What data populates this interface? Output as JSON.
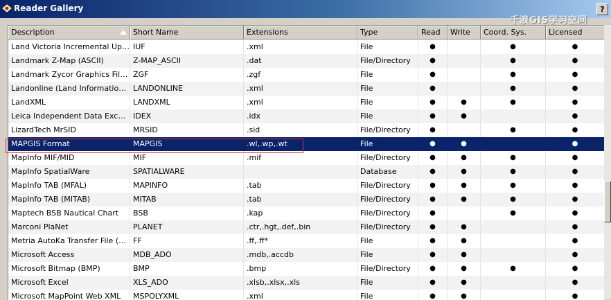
{
  "window": {
    "title": "Reader Gallery",
    "help_label": "?",
    "watermark": "千浪GIS学习空间"
  },
  "columns": [
    "Description",
    "Short Name",
    "Extensions",
    "Type",
    "Read",
    "Write",
    "Coord. Sys.",
    "Licensed"
  ],
  "dot": "●",
  "rows": [
    {
      "desc": "Land Victoria Incremental Update...",
      "short": "IUF",
      "ext": ".xml",
      "type": "File",
      "read": true,
      "write": false,
      "coord": true,
      "lic": true
    },
    {
      "desc": "Landmark Z-Map (ASCII)",
      "short": "Z-MAP_ASCII",
      "ext": ".dat",
      "type": "File/Directory",
      "read": true,
      "write": false,
      "coord": true,
      "lic": true
    },
    {
      "desc": "Landmark Zycor Graphics File (ZGF)",
      "short": "ZGF",
      "ext": ".zgf",
      "type": "File",
      "read": true,
      "write": false,
      "coord": true,
      "lic": true
    },
    {
      "desc": "Landonline (Land Information Ne...",
      "short": "LANDONLINE",
      "ext": ".xml",
      "type": "File",
      "read": true,
      "write": false,
      "coord": true,
      "lic": true
    },
    {
      "desc": "LandXML",
      "short": "LANDXML",
      "ext": ".xml",
      "type": "File",
      "read": true,
      "write": true,
      "coord": true,
      "lic": true
    },
    {
      "desc": "Leica Independent Data Exchang...",
      "short": "IDEX",
      "ext": ".idx",
      "type": "File",
      "read": true,
      "write": true,
      "coord": false,
      "lic": true
    },
    {
      "desc": "LizardTech MrSID",
      "short": "MRSID",
      "ext": ".sid",
      "type": "File/Directory",
      "read": true,
      "write": false,
      "coord": true,
      "lic": true
    },
    {
      "desc": "MAPGIS Format",
      "short": "MAPGIS",
      "ext": ".wl,.wp,.wt",
      "type": "File",
      "read": true,
      "write": true,
      "coord": false,
      "lic": true,
      "selected": true
    },
    {
      "desc": "MapInfo MIF/MID",
      "short": "MIF",
      "ext": ".mif",
      "type": "File/Directory",
      "read": true,
      "write": true,
      "coord": true,
      "lic": true
    },
    {
      "desc": "MapInfo SpatialWare",
      "short": "SPATIALWARE",
      "ext": "",
      "type": "Database",
      "read": true,
      "write": true,
      "coord": true,
      "lic": true
    },
    {
      "desc": "MapInfo TAB (MFAL)",
      "short": "MAPINFO",
      "ext": ".tab",
      "type": "File/Directory",
      "read": true,
      "write": true,
      "coord": true,
      "lic": true
    },
    {
      "desc": "MapInfo TAB (MITAB)",
      "short": "MITAB",
      "ext": ".tab",
      "type": "File/Directory",
      "read": true,
      "write": true,
      "coord": true,
      "lic": true
    },
    {
      "desc": "Maptech BSB Nautical Chart",
      "short": "BSB",
      "ext": ".kap",
      "type": "File/Directory",
      "read": true,
      "write": false,
      "coord": true,
      "lic": true
    },
    {
      "desc": "Marconi PlaNet",
      "short": "PLANET",
      "ext": ".ctr,.hgt,.def,.bin",
      "type": "File/Directory",
      "read": true,
      "write": true,
      "coord": false,
      "lic": true
    },
    {
      "desc": "Metria AutoKa Transfer File (FF)",
      "short": "FF",
      "ext": ".ff,.ff*",
      "type": "File",
      "read": true,
      "write": true,
      "coord": false,
      "lic": true
    },
    {
      "desc": "Microsoft Access",
      "short": "MDB_ADO",
      "ext": ".mdb,.accdb",
      "type": "File",
      "read": true,
      "write": true,
      "coord": false,
      "lic": true
    },
    {
      "desc": "Microsoft Bitmap (BMP)",
      "short": "BMP",
      "ext": ".bmp",
      "type": "File/Directory",
      "read": true,
      "write": true,
      "coord": true,
      "lic": true
    },
    {
      "desc": "Microsoft Excel",
      "short": "XLS_ADO",
      "ext": ".xlsb,.xlsx,.xls",
      "type": "File",
      "read": true,
      "write": true,
      "coord": false,
      "lic": true
    },
    {
      "desc": "Microsoft MapPoint Web XML",
      "short": "MSPOLYXML",
      "ext": ".xml",
      "type": "File",
      "read": true,
      "write": true,
      "coord": false,
      "lic": true
    }
  ]
}
